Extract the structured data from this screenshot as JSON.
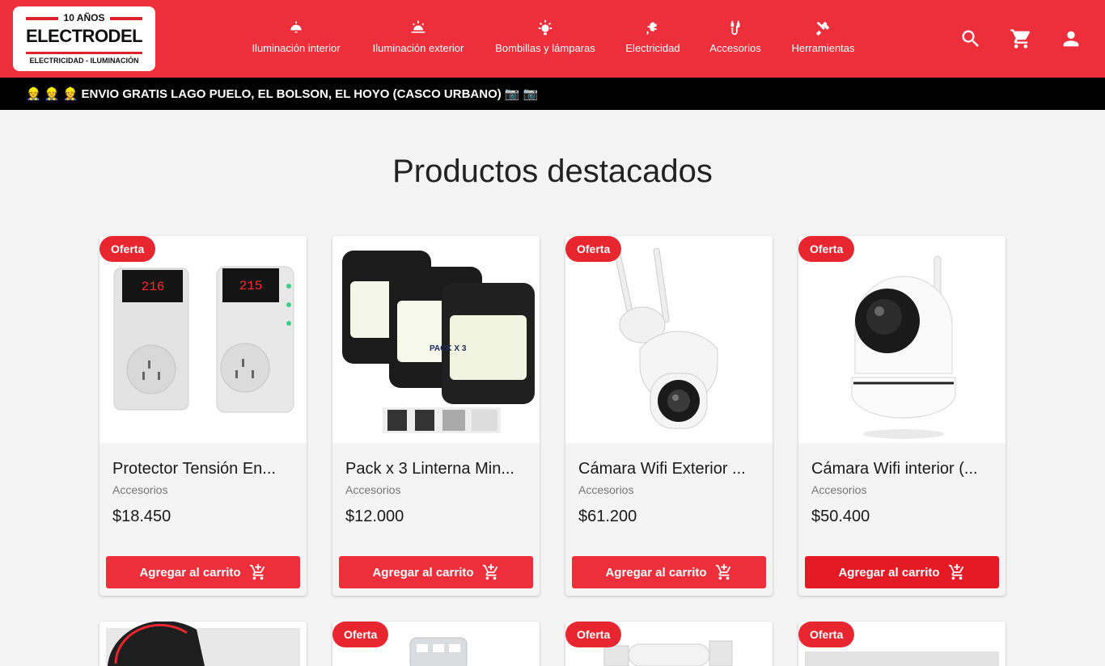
{
  "header": {
    "logo": {
      "years": "10 AÑOS",
      "brand": "ELECTRODEL",
      "tagline": "ELECTRICIDAD - ILUMINACIÓN"
    },
    "nav": [
      {
        "label": "Iluminación interior",
        "icon": "ceiling-lamp-icon"
      },
      {
        "label": "Iluminación exterior",
        "icon": "sunrise-icon"
      },
      {
        "label": "Bombillas y lámparas",
        "icon": "bulb-icon"
      },
      {
        "label": "Electricidad",
        "icon": "plug-icon"
      },
      {
        "label": "Accesorios",
        "icon": "cable-icon"
      },
      {
        "label": "Herramientas",
        "icon": "tools-icon"
      }
    ],
    "actions": [
      "search-icon",
      "cart-icon",
      "user-icon"
    ]
  },
  "announcement": {
    "prefix": "👷 👷 👷",
    "text": "ENVIO GRATIS LAGO PUELO, EL BOLSON, EL HOYO (CASCO URBANO)",
    "suffix": "📷 📷"
  },
  "section": {
    "title": "Productos destacados"
  },
  "products": [
    {
      "badge": "Oferta",
      "name": "Protector Tensión En...",
      "category": "Accesorios",
      "price": "$18.450",
      "button": "Agregar al carrito"
    },
    {
      "badge": "",
      "name": "Pack x 3 Linterna Min...",
      "category": "Accesorios",
      "price": "$12.000",
      "button": "Agregar al carrito"
    },
    {
      "badge": "Oferta",
      "name": "Cámara Wifi Exterior ...",
      "category": "Accesorios",
      "price": "$61.200",
      "button": "Agregar al carrito"
    },
    {
      "badge": "Oferta",
      "name": "Cámara Wifi interior (...",
      "category": "Accesorios",
      "price": "$50.400",
      "button": "Agregar al carrito"
    }
  ],
  "products_row2": [
    {
      "badge": ""
    },
    {
      "badge": "Oferta"
    },
    {
      "badge": "Oferta"
    },
    {
      "badge": "Oferta"
    }
  ],
  "colors": {
    "brand_red": "#ec2f3a",
    "badge_red": "#e8262f",
    "announce_bg": "#000000"
  }
}
